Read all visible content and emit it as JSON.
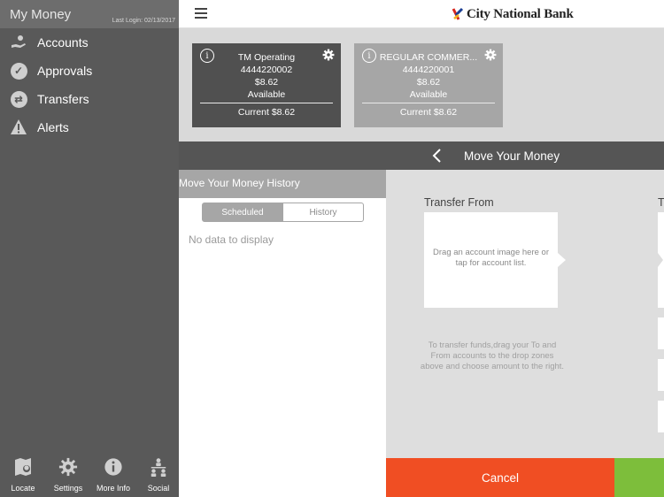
{
  "sidebar": {
    "title": "My Money",
    "last_login": "Last Login: 02/13/2017",
    "items": [
      {
        "label": "Accounts",
        "icon": "hand-coin-icon"
      },
      {
        "label": "Approvals",
        "icon": "checkmark-circle-icon"
      },
      {
        "label": "Transfers",
        "icon": "transfer-arrows-icon"
      },
      {
        "label": "Alerts",
        "icon": "warning-triangle-icon"
      }
    ],
    "bottom": [
      {
        "label": "Locate",
        "icon": "map-pin-icon"
      },
      {
        "label": "Settings",
        "icon": "gear-icon"
      },
      {
        "label": "More Info",
        "icon": "info-circle-icon"
      },
      {
        "label": "Social",
        "icon": "people-icon"
      }
    ]
  },
  "header": {
    "brand_name": "City National Bank",
    "logo": "city-national-bank-logo"
  },
  "accounts": [
    {
      "name": "TM Operating",
      "number": "4444220002",
      "balance": "$8.62",
      "available_label": "Available",
      "current": "Current $8.62"
    },
    {
      "name": "REGULAR COMMER...",
      "number": "4444220001",
      "balance": "$8.62",
      "available_label": "Available",
      "current": "Current $8.62"
    }
  ],
  "title_bar": {
    "title": "Move Your Money"
  },
  "history": {
    "title": "Move Your Money History",
    "tabs": [
      "Scheduled",
      "History"
    ],
    "selected_tab": "Scheduled",
    "empty_message": "No data to display"
  },
  "transfer": {
    "from_label": "Transfer From",
    "to_label": "T",
    "drop_hint": "Drag an account image here or tap for account list.",
    "instructions": "To transfer funds,drag your To and From accounts to the drop zones above and choose amount to the right."
  },
  "actions": {
    "cancel_label": "Cancel"
  },
  "colors": {
    "sidebar_bg": "#595959",
    "cancel": "#f04e23",
    "submit": "#7dbe3b",
    "title_bar": "#555555"
  }
}
